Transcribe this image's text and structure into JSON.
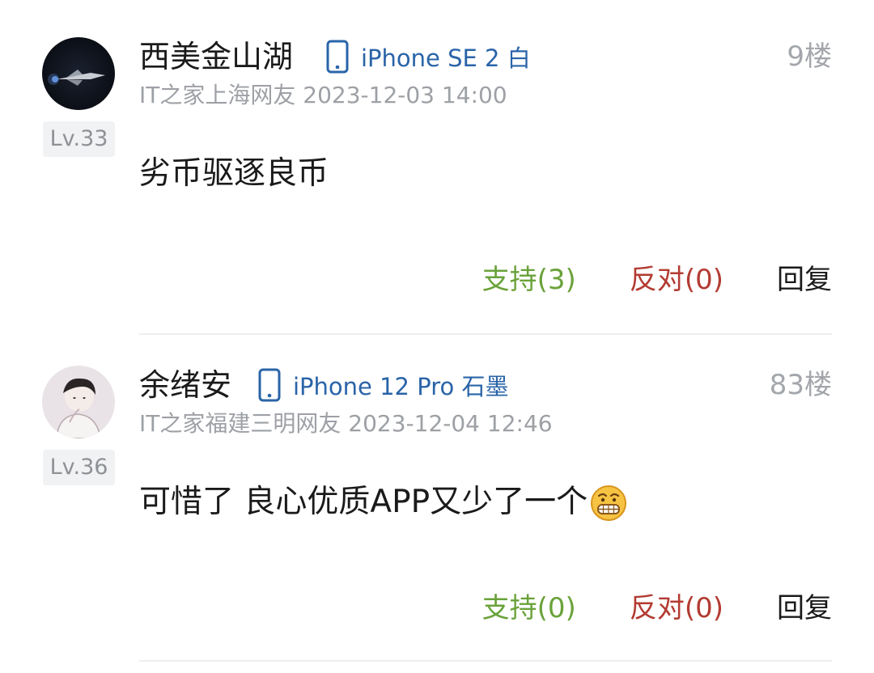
{
  "comments": [
    {
      "username": "西美金山湖",
      "device": "iPhone SE 2 白",
      "floor": "9楼",
      "meta": "IT之家上海网友 2023-12-03 14:00",
      "level": "Lv.33",
      "content": "劣币驱逐良币",
      "support": "支持(3)",
      "oppose": "反对(0)",
      "reply": "回复",
      "avatar_icon": "space-shuttle-avatar"
    },
    {
      "username": "余绪安",
      "device": "iPhone 12 Pro 石墨",
      "floor": "83楼",
      "meta": "IT之家福建三明网友 2023-12-04 12:46",
      "level": "Lv.36",
      "content": "可惜了 良心优质APP又少了一个",
      "content_emoji": "grimace-emoji",
      "support": "支持(0)",
      "oppose": "反对(0)",
      "reply": "回复",
      "avatar_icon": "boy-sketch-avatar"
    }
  ],
  "colors": {
    "device": "#2a64a8",
    "support": "#6aa23a",
    "oppose": "#b33b32",
    "meta": "#9da0a5"
  }
}
